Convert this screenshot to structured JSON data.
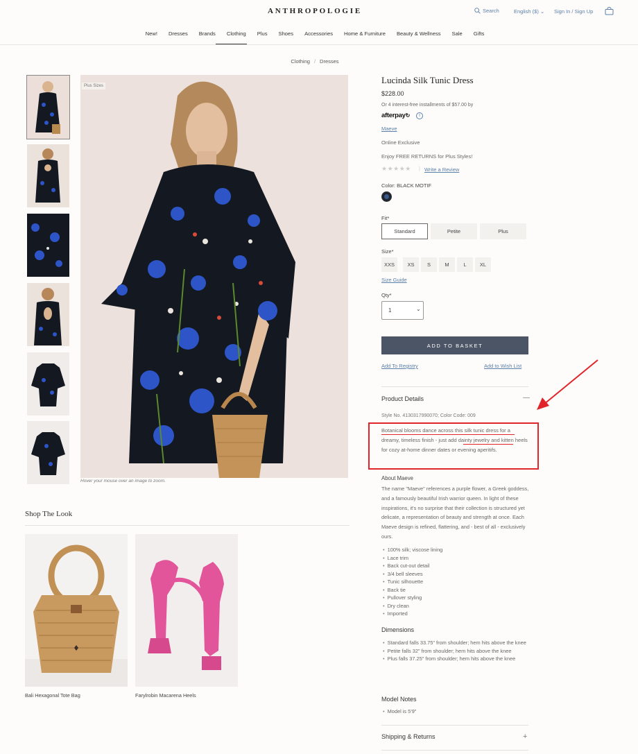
{
  "header": {
    "logo": "ANTHROPOLOGIE",
    "search": "Search",
    "language": "English ($)",
    "sign_in": "Sign In / Sign Up"
  },
  "nav": [
    "New!",
    "Dresses",
    "Brands",
    "Clothing",
    "Plus",
    "Shoes",
    "Accessories",
    "Home & Furniture",
    "Beauty & Wellness",
    "Sale",
    "Gifts"
  ],
  "breadcrumb": [
    "Clothing",
    "Dresses"
  ],
  "gallery": {
    "badge": "Plus Sizes",
    "hover_note": "Hover your mouse over an image to zoom."
  },
  "product": {
    "title": "Lucinda Silk Tunic Dress",
    "price": "$228.00",
    "installments": "Or 4 interest-free installments of $57.00 by",
    "afterpay": "afterpay",
    "brand": "Maeve",
    "online_exclusive": "Online Exclusive",
    "free_returns": "Enjoy FREE RETURNS for Plus Styles!",
    "stars": "★★★★★",
    "write_review": "Write a Review",
    "color_label": "Color:",
    "color_value": "BLACK MOTIF",
    "fit_label": "Fit*",
    "fits": [
      "Standard",
      "Petite",
      "Plus"
    ],
    "size_label": "Size*",
    "sizes": [
      "XXS",
      "XS",
      "S",
      "M",
      "L",
      "XL"
    ],
    "size_guide": "Size Guide",
    "qty_label": "Qty*",
    "qty_value": "1",
    "add_to_basket": "ADD TO BASKET",
    "add_to_registry": "Add To Registry",
    "add_to_wishlist": "Add to Wish List"
  },
  "details": {
    "title": "Product Details",
    "toggle": "—",
    "style_no": "Style No. 4130317990070; Color Code: 009",
    "description": "Botanical blooms dance across this silk tunic dress for a dreamy, timeless finish - just add dainty jewelry and kitten heels for cozy at-home dinner dates or evening aperitifs.",
    "about_title": "About Maeve",
    "about": "The name \"Maeve\" references a purple flower, a Greek goddess, and a famously beautiful Irish warrior queen. In light of these inspirations, it's no surprise that their collection is structured yet delicate, a representation of beauty and strength at once. Each Maeve design is refined, flattering, and - best of all - exclusively ours.",
    "features": [
      "100% silk; viscose lining",
      "Lace trim",
      "Back cut-out detail",
      "3/4 bell sleeves",
      "Tunic silhouette",
      "Back tie",
      "Pullover styling",
      "Dry clean",
      "Imported"
    ],
    "dimensions_title": "Dimensions",
    "dimensions": [
      "Standard falls 33.75\" from shoulder; hem hits above the knee",
      "Petite falls 32\" from shoulder; hem hits above the knee",
      "Plus falls 37.25\" from shoulder; hem hits above the knee"
    ],
    "model_title": "Model Notes",
    "model_notes": [
      "Model is 5'9\""
    ],
    "shipping_title": "Shipping & Returns",
    "shipping_toggle": "+"
  },
  "shop_the_look": {
    "title": "Shop The Look",
    "items": [
      "Bali Hexagonal Tote Bag",
      "Farylrobin Macarena Heels"
    ]
  },
  "colors": {
    "link": "#5a7fa8",
    "button": "#4b5566",
    "annotation": "#e0242a"
  }
}
